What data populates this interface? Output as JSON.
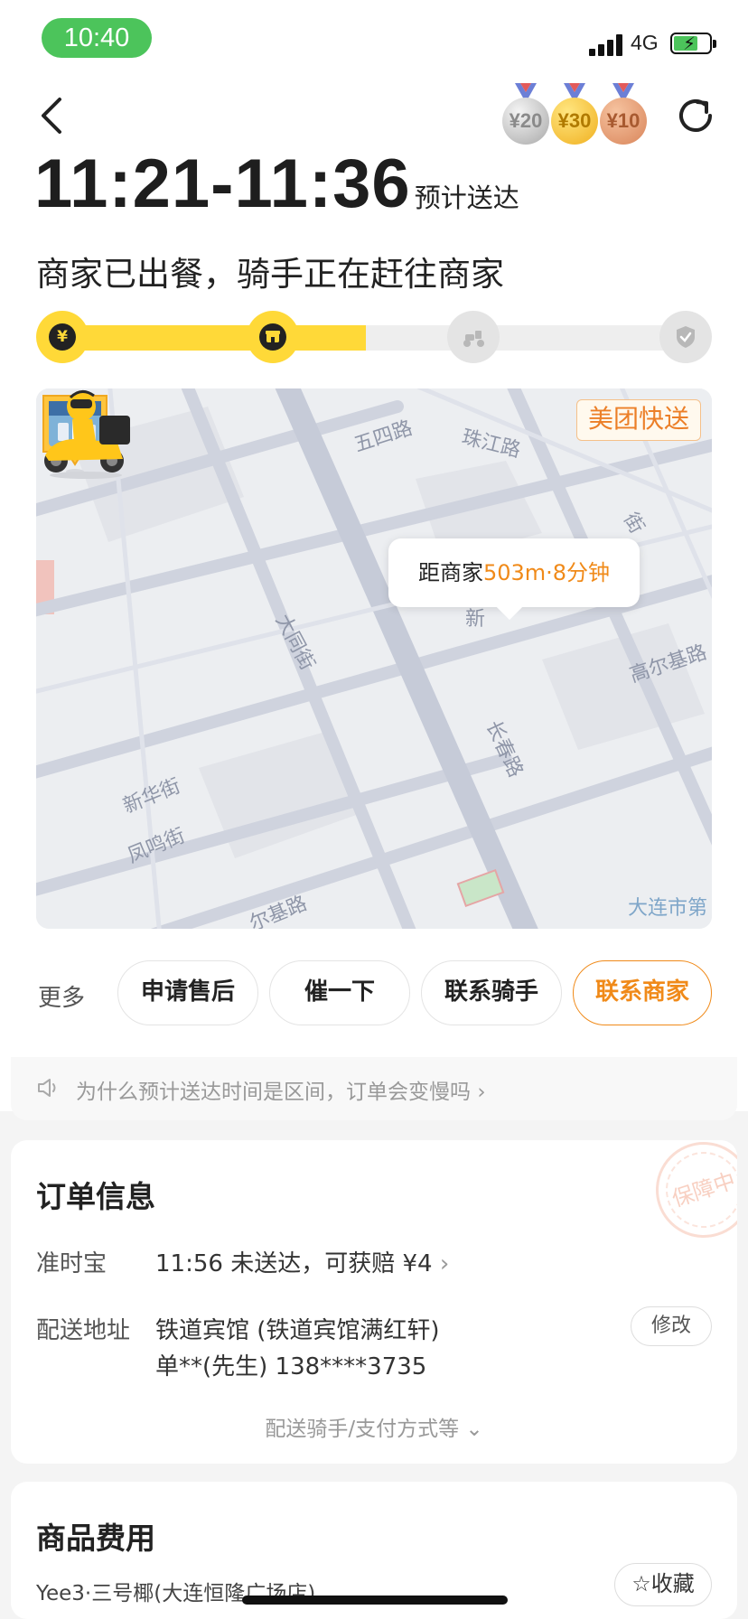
{
  "status_bar": {
    "time": "10:40",
    "network": "4G"
  },
  "header": {
    "medals": [
      {
        "label": "¥20",
        "tier": "silver"
      },
      {
        "label": "¥30",
        "tier": "gold"
      },
      {
        "label": "¥10",
        "tier": "bronze"
      }
    ]
  },
  "eta": {
    "time_range": "11:21-11:36",
    "label": "预计送达"
  },
  "status_text": "商家已出餐，骑手正在赶往商家",
  "progress": {
    "fraction": 0.5,
    "steps": [
      {
        "icon": "yuan-icon",
        "glyph": "¥",
        "active": true
      },
      {
        "icon": "shop-icon",
        "glyph": "",
        "active": true
      },
      {
        "icon": "scooter-icon",
        "glyph": "",
        "active": false
      },
      {
        "icon": "check-icon",
        "glyph": "",
        "active": false
      }
    ]
  },
  "map": {
    "badge": "美团快送",
    "bubble_prefix": "距商家",
    "bubble_highlight": "503m·8分钟",
    "streets": {
      "wusi": "五四路",
      "zhujiang": "珠江路",
      "datong": "大同街",
      "changchun": "长春路",
      "gaoerji": "高尔基路",
      "xinhua": "新华街",
      "fengming": "凤鸣街",
      "erjilu": "尔基路",
      "dalian": "大连市第",
      "jie": "街",
      "xin": "新"
    }
  },
  "actions": {
    "more_label": "更多",
    "buttons": [
      "申请售后",
      "催一下",
      "联系骑手",
      "联系商家"
    ]
  },
  "notice": {
    "text": "为什么预计送达时间是区间，订单会变慢吗",
    "chevron": "›"
  },
  "order_info": {
    "title": "订单信息",
    "stamp": "保障中",
    "ontime_label": "准时宝",
    "ontime_value": "11:56 未送达，可获赔 ¥4",
    "chevron": "›",
    "address_label": "配送地址",
    "address_line1": "铁道宾馆 (铁道宾馆满红轩)",
    "address_line2": "单**(先生) 138****3735",
    "modify_label": "修改",
    "expand_label": "配送骑手/支付方式等",
    "expand_chevron": "⌄"
  },
  "cost": {
    "title": "商品费用",
    "store_name": "Yee3·三号椰(大连恒隆广场店)",
    "fav_label": "收藏",
    "fav_icon": "☆"
  },
  "colors": {
    "accent_yellow": "#ffd938",
    "accent_orange": "#f08a19",
    "status_green": "#4cc45b"
  }
}
